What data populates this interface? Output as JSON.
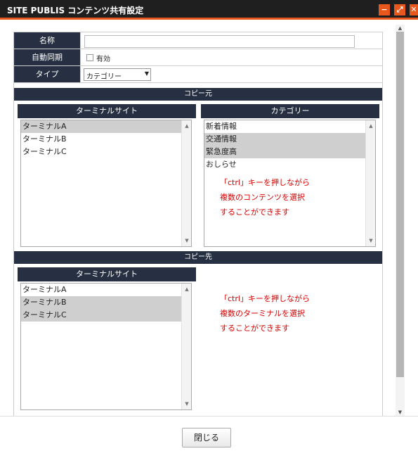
{
  "window": {
    "title": "SITE PUBLIS コンテンツ共有設定",
    "minimize_glyph": "−",
    "maximize_glyph": "⤢",
    "close_glyph": "✕",
    "accent_color": "#e8571c",
    "header_color": "#263042"
  },
  "form": {
    "name_label": "名称",
    "name_value": "",
    "autosync_label": "自動同期",
    "autosync_checkbox_label": "有効",
    "autosync_checked": false,
    "type_label": "タイプ",
    "type_selected": "カテゴリー",
    "type_dropdown_arrow": "▼"
  },
  "copy_source": {
    "section_label": "コピー元",
    "terminal_header": "ターミナルサイト",
    "terminal_items": [
      {
        "label": "ターミナルA",
        "selected": true
      },
      {
        "label": "ターミナルB",
        "selected": false
      },
      {
        "label": "ターミナルC",
        "selected": false
      }
    ],
    "category_header": "カテゴリー",
    "category_items": [
      {
        "label": "新着情報",
        "selected": false
      },
      {
        "label": "交通情報",
        "selected": true
      },
      {
        "label": "緊急度高",
        "selected": true
      },
      {
        "label": "おしらせ",
        "selected": false
      }
    ],
    "note_lines": [
      "「ctrl」キーを押しながら",
      "複数のコンテンツを選択",
      "することができます"
    ]
  },
  "copy_dest": {
    "section_label": "コピー先",
    "terminal_header": "ターミナルサイト",
    "terminal_items": [
      {
        "label": "ターミナルA",
        "selected": false
      },
      {
        "label": "ターミナルB",
        "selected": true
      },
      {
        "label": "ターミナルC",
        "selected": true
      }
    ],
    "note_lines": [
      "「ctrl」キーを押しながら",
      "複数のターミナルを選択",
      "することができます"
    ]
  },
  "scroll": {
    "up": "▲",
    "down": "▼"
  },
  "footer": {
    "close_label": "閉じる"
  }
}
